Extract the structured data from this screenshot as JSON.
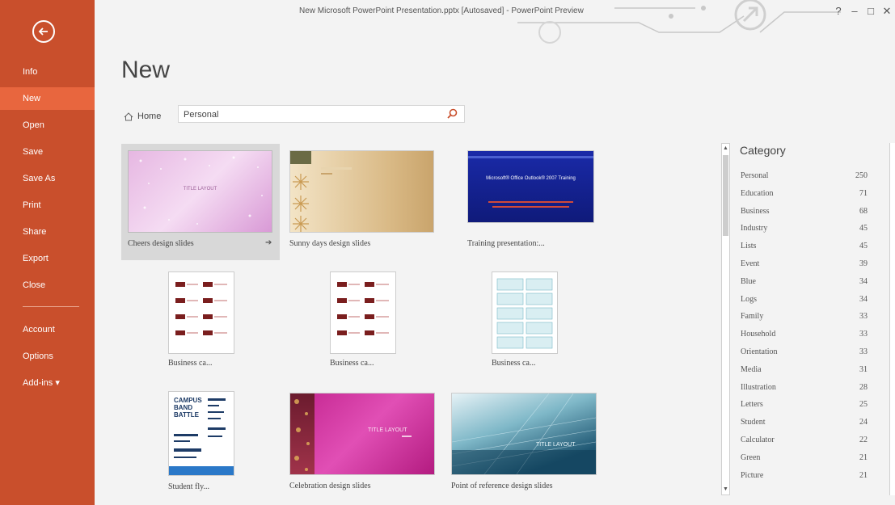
{
  "window": {
    "title": "New Microsoft PowerPoint Presentation.pptx [Autosaved] - PowerPoint Preview",
    "controls": [
      "?",
      "–",
      "□",
      "✕"
    ]
  },
  "sidebar": {
    "items": [
      {
        "label": "Info"
      },
      {
        "label": "New"
      },
      {
        "label": "Open"
      },
      {
        "label": "Save"
      },
      {
        "label": "Save As"
      },
      {
        "label": "Print"
      },
      {
        "label": "Share"
      },
      {
        "label": "Export"
      },
      {
        "label": "Close"
      },
      {
        "label": "Account"
      },
      {
        "label": "Options"
      },
      {
        "label": "Add-ins ▾"
      }
    ]
  },
  "main": {
    "title": "New",
    "home_label": "Home",
    "search_value": "Personal"
  },
  "templates": [
    {
      "label": "Cheers design slides",
      "thumb_text": "TITLE LAYOUT"
    },
    {
      "label": "Sunny days design slides"
    },
    {
      "label": "Training presentation:...",
      "thumb_title": "Microsoft® Office Outlook® 2007 Training"
    },
    {
      "label": "Business ca..."
    },
    {
      "label": "Business ca..."
    },
    {
      "label": "Business ca..."
    },
    {
      "label": "Student fly...",
      "thumb_text": "CAMPUS BAND BATTLE"
    },
    {
      "label": "Celebration design slides",
      "thumb_text": "TITLE LAYOUT"
    },
    {
      "label": "Point of reference design slides",
      "thumb_text": "TITLE LAYOUT"
    }
  ],
  "category": {
    "title": "Category",
    "items": [
      {
        "name": "Personal",
        "count": "250"
      },
      {
        "name": "Education",
        "count": "71"
      },
      {
        "name": "Business",
        "count": "68"
      },
      {
        "name": "Industry",
        "count": "45"
      },
      {
        "name": "Lists",
        "count": "45"
      },
      {
        "name": "Event",
        "count": "39"
      },
      {
        "name": "Blue",
        "count": "34"
      },
      {
        "name": "Logs",
        "count": "34"
      },
      {
        "name": "Family",
        "count": "33"
      },
      {
        "name": "Household",
        "count": "33"
      },
      {
        "name": "Orientation",
        "count": "33"
      },
      {
        "name": "Media",
        "count": "31"
      },
      {
        "name": "Illustration",
        "count": "28"
      },
      {
        "name": "Letters",
        "count": "25"
      },
      {
        "name": "Student",
        "count": "24"
      },
      {
        "name": "Calculator",
        "count": "22"
      },
      {
        "name": "Green",
        "count": "21"
      },
      {
        "name": "Picture",
        "count": "21"
      }
    ]
  },
  "colors": {
    "sidebar": "#c94f2c",
    "sidebar_active": "#e8663e",
    "search_icon": "#c94f2c"
  }
}
